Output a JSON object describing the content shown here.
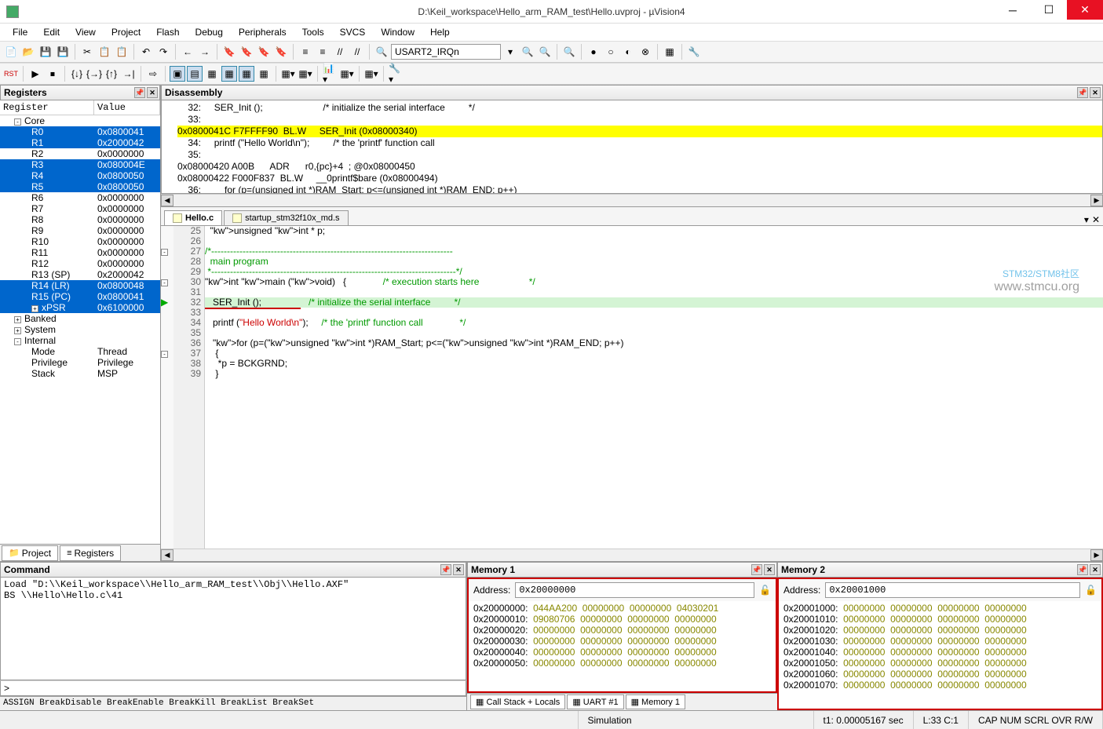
{
  "window": {
    "title": "D:\\Keil_workspace\\Hello_arm_RAM_test\\Hello.uvproj - µVision4"
  },
  "menu": [
    "File",
    "Edit",
    "View",
    "Project",
    "Flash",
    "Debug",
    "Peripherals",
    "Tools",
    "SVCS",
    "Window",
    "Help"
  ],
  "toolbar_combo": "USART2_IRQn",
  "registers_panel": {
    "title": "Registers",
    "col1": "Register",
    "col2": "Value"
  },
  "registers": [
    {
      "n": "Core",
      "v": "",
      "grp": true,
      "exp": "-"
    },
    {
      "n": "R0",
      "v": "0x0800041",
      "sel": true
    },
    {
      "n": "R1",
      "v": "0x2000042",
      "sel": true
    },
    {
      "n": "R2",
      "v": "0x0000000"
    },
    {
      "n": "R3",
      "v": "0x080004E",
      "sel": true
    },
    {
      "n": "R4",
      "v": "0x0800050",
      "sel": true
    },
    {
      "n": "R5",
      "v": "0x0800050",
      "sel": true
    },
    {
      "n": "R6",
      "v": "0x0000000"
    },
    {
      "n": "R7",
      "v": "0x0000000"
    },
    {
      "n": "R8",
      "v": "0x0000000"
    },
    {
      "n": "R9",
      "v": "0x0000000"
    },
    {
      "n": "R10",
      "v": "0x0000000"
    },
    {
      "n": "R11",
      "v": "0x0000000"
    },
    {
      "n": "R12",
      "v": "0x0000000"
    },
    {
      "n": "R13 (SP)",
      "v": "0x2000042"
    },
    {
      "n": "R14 (LR)",
      "v": "0x0800048",
      "sel": true
    },
    {
      "n": "R15 (PC)",
      "v": "0x0800041",
      "sel": true
    },
    {
      "n": "xPSR",
      "v": "0x6100000",
      "sel": true,
      "exp": "+"
    },
    {
      "n": "Banked",
      "v": "",
      "grp": true,
      "exp": "+"
    },
    {
      "n": "System",
      "v": "",
      "grp": true,
      "exp": "+"
    },
    {
      "n": "Internal",
      "v": "",
      "grp": true,
      "exp": "-"
    },
    {
      "n": "Mode",
      "v": "Thread",
      "sub": true
    },
    {
      "n": "Privilege",
      "v": "Privilege",
      "sub": true
    },
    {
      "n": "Stack",
      "v": "MSP",
      "sub": true
    }
  ],
  "reg_tabs": [
    "Project",
    "Registers"
  ],
  "disassembly": {
    "title": "Disassembly",
    "lines": [
      "    32:     SER_Init ();                       /* initialize the serial interface         */",
      "    33: ",
      "0x0800041C F7FFFF90  BL.W     SER_Init (0x08000340)",
      "    34:     printf (\"Hello World\\n\");         /* the 'printf' function call",
      "    35:",
      "0x08000420 A00B      ADR      r0,{pc}+4  ; @0x08000450",
      "0x08000422 F000F837  BL.W     __0printf$bare (0x08000494)",
      "    36:         for (p=(unsigned int *)RAM_Start; p<=(unsigned int *)RAM_END; p++)"
    ],
    "hl": 2
  },
  "code_tabs": [
    {
      "label": "Hello.c",
      "active": true
    },
    {
      "label": "startup_stm32f10x_md.s"
    }
  ],
  "code": {
    "start": 25,
    "bp_line": 32,
    "lines": [
      {
        "t": "  unsigned int * p;"
      },
      {
        "t": ""
      },
      {
        "t": "/*-----------------------------------------------------------------------------",
        "fold": "-",
        "cls": "cmt"
      },
      {
        "t": "  main program",
        "cls": "cmt"
      },
      {
        "t": " *------------------------------------------------------------------------------*/",
        "cls": "cmt"
      },
      {
        "t": "int main (void)   {              /* execution starts here                   */",
        "fold": "-"
      },
      {
        "t": ""
      },
      {
        "t": "   SER_Init ();                  /* initialize the serial interface         */",
        "bp": true
      },
      {
        "t": ""
      },
      {
        "t": "   printf (\"Hello World\\n\");     /* the 'printf' function call              */"
      },
      {
        "t": ""
      },
      {
        "t": "   for (p=(unsigned int *)RAM_Start; p<=(unsigned int *)RAM_END; p++)"
      },
      {
        "t": "    {",
        "fold": "-"
      },
      {
        "t": "     *p = BCKGRND;"
      },
      {
        "t": "    }"
      }
    ]
  },
  "command": {
    "title": "Command",
    "body": "Load \"D:\\\\Keil_workspace\\\\Hello_arm_RAM_test\\\\Obj\\\\Hello.AXF\"\nBS \\\\Hello\\Hello.c\\41",
    "prompt": ">",
    "hints": "ASSIGN BreakDisable BreakEnable BreakKill BreakList BreakSet"
  },
  "memory1": {
    "title": "Memory 1",
    "addr_label": "Address:",
    "addr": "0x20000000",
    "rows": [
      [
        "0x20000000:",
        "044AA200",
        "00000000",
        "00000000",
        "04030201"
      ],
      [
        "0x20000010:",
        "09080706",
        "00000000",
        "00000000",
        "00000000"
      ],
      [
        "0x20000020:",
        "00000000",
        "00000000",
        "00000000",
        "00000000"
      ],
      [
        "0x20000030:",
        "00000000",
        "00000000",
        "00000000",
        "00000000"
      ],
      [
        "0x20000040:",
        "00000000",
        "00000000",
        "00000000",
        "00000000"
      ],
      [
        "0x20000050:",
        "00000000",
        "00000000",
        "00000000",
        "00000000"
      ]
    ]
  },
  "memory2": {
    "title": "Memory 2",
    "addr_label": "Address:",
    "addr": "0x20001000",
    "rows": [
      [
        "0x20001000:",
        "00000000",
        "00000000",
        "00000000",
        "00000000"
      ],
      [
        "0x20001010:",
        "00000000",
        "00000000",
        "00000000",
        "00000000"
      ],
      [
        "0x20001020:",
        "00000000",
        "00000000",
        "00000000",
        "00000000"
      ],
      [
        "0x20001030:",
        "00000000",
        "00000000",
        "00000000",
        "00000000"
      ],
      [
        "0x20001040:",
        "00000000",
        "00000000",
        "00000000",
        "00000000"
      ],
      [
        "0x20001050:",
        "00000000",
        "00000000",
        "00000000",
        "00000000"
      ],
      [
        "0x20001060:",
        "00000000",
        "00000000",
        "00000000",
        "00000000"
      ],
      [
        "0x20001070:",
        "00000000",
        "00000000",
        "00000000",
        "00000000"
      ]
    ]
  },
  "bottom_tabs": [
    "Call Stack + Locals",
    "UART #1",
    "Memory 1"
  ],
  "status": {
    "sim": "Simulation",
    "time": "t1: 0.00005167 sec",
    "pos": "L:33 C:1",
    "flags": [
      "CAP",
      "NUM",
      "SCRL",
      "OVR",
      "R/W"
    ]
  },
  "watermark": {
    "l1": "STM32/STM8社区",
    "l2": "www.stmcu.org"
  }
}
